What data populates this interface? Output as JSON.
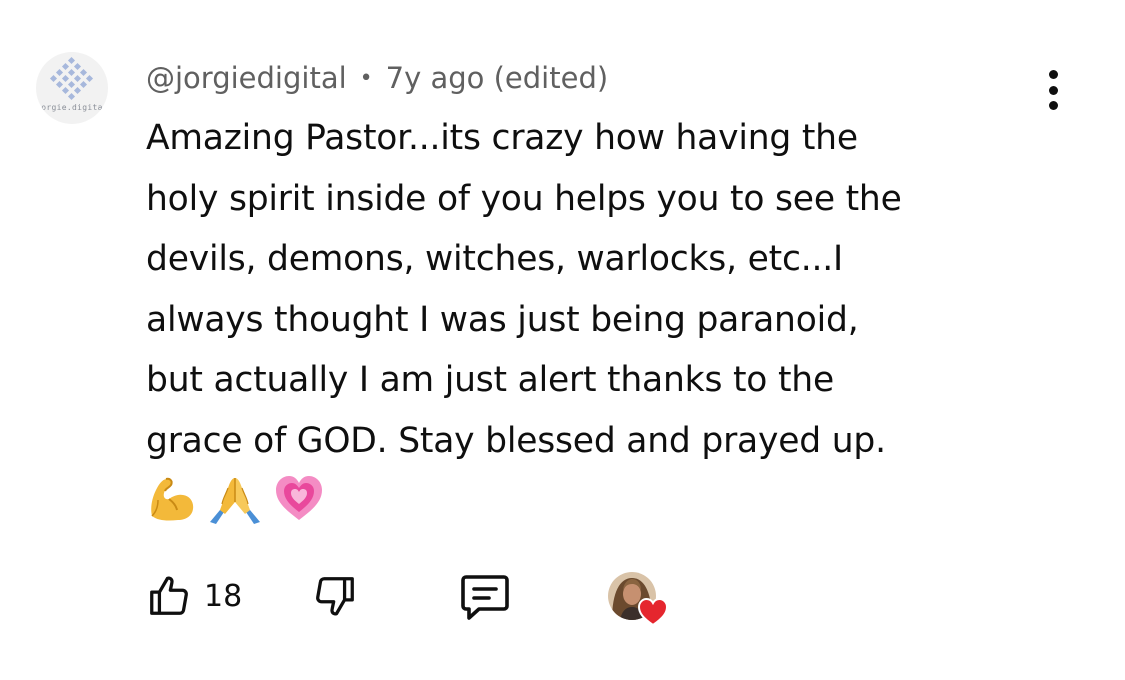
{
  "comment": {
    "author_avatar_caption": "orgie.digita",
    "author_handle": "@jorgiedigital",
    "separator": "•",
    "timestamp": "7y ago (edited)",
    "text_lines": [
      "Amazing Pastor...its crazy how having the",
      "holy spirit inside of you helps you to see the",
      "devils, demons, witches, warlocks, etc...I",
      "always thought I was just being paranoid,",
      "but actually I am just alert thanks to the",
      "grace of GOD. Stay blessed and prayed up."
    ],
    "emojis": [
      "flexed-biceps",
      "folded-hands",
      "growing-heart"
    ],
    "like_count": "18"
  },
  "icons": {
    "menu": "more-vertical-icon",
    "like": "thumbs-up-icon",
    "dislike": "thumbs-down-icon",
    "reply": "reply-comment-icon",
    "creator_heart": "heart-icon"
  },
  "colors": {
    "text": "#0f0f0f",
    "meta": "#606060",
    "heart": "#e5262e",
    "avatar_diamond": "#a7b8dc"
  }
}
